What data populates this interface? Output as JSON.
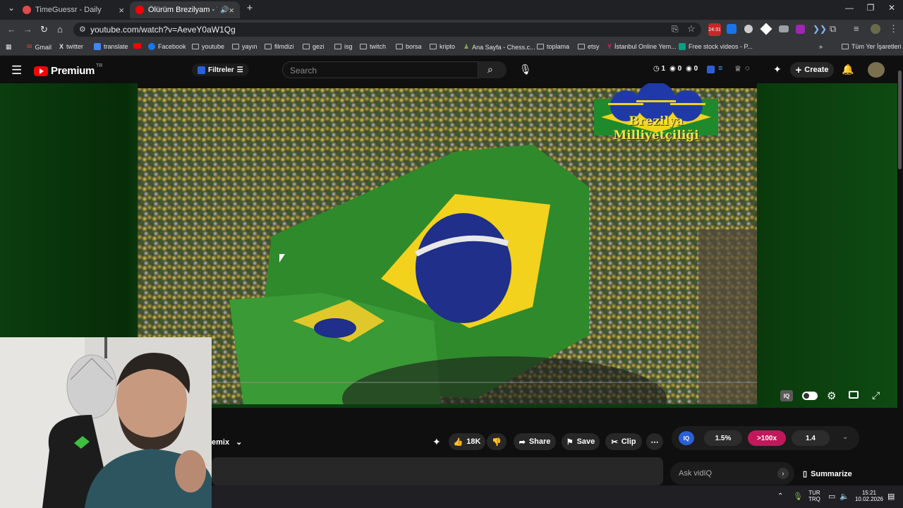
{
  "browser": {
    "tabs": [
      {
        "title": "TimeGuessr - Daily",
        "favicon_color": "#e24b4b"
      },
      {
        "title": "Ölürüm Brezilyam - YouTub",
        "favicon_color": "#ff0000"
      }
    ],
    "url": "youtube.com/watch?v=AeveY0aW1Qg",
    "badge_count": "24:31"
  },
  "bookmarks": [
    {
      "label": "Gmail"
    },
    {
      "label": "twitter"
    },
    {
      "label": "translate"
    },
    {
      "label": ""
    },
    {
      "label": "Facebook"
    },
    {
      "label": "youtube"
    },
    {
      "label": "yayın"
    },
    {
      "label": "filmdizi"
    },
    {
      "label": "gezi"
    },
    {
      "label": "isg"
    },
    {
      "label": "twitch"
    },
    {
      "label": "borsa"
    },
    {
      "label": "kripto"
    },
    {
      "label": "Ana Sayfa - Chess.c..."
    },
    {
      "label": "toplama"
    },
    {
      "label": "etsy"
    },
    {
      "label": "İstanbul Online Yem..."
    },
    {
      "label": "Free stock videos - P..."
    },
    {
      "label": "Tüm Yer İşaretleri"
    }
  ],
  "youtube": {
    "logo_text": "Premium",
    "region": "TR",
    "filters_label": "Filtreler",
    "search_placeholder": "Search",
    "stats": [
      "1",
      "0",
      "0"
    ],
    "create_label": "Create"
  },
  "video": {
    "overlay_logo_text": "Brezilya Milliyetçiliği",
    "colors": {
      "green": "#2f8a2c",
      "yellow": "#f2d21c",
      "blue": "#1f2f8a"
    }
  },
  "actions": {
    "channel_fragment": "emix",
    "likes": "18K",
    "share": "Share",
    "save": "Save",
    "clip": "Clip"
  },
  "vidiq": {
    "metric1": "1.5%",
    "metric2": ">100x",
    "metric3": "1.4",
    "ask_placeholder": "Ask vidIQ",
    "summarize": "Summarize"
  },
  "taskbar": {
    "lang1": "TUR",
    "lang2": "TRQ",
    "time": "15:21",
    "date": "10.02.2026"
  }
}
